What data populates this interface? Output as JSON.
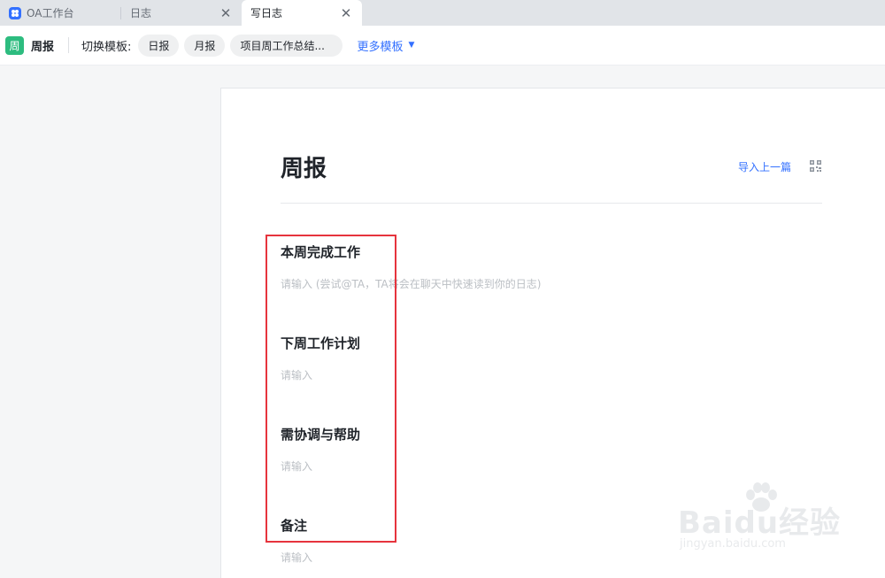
{
  "tabs": [
    {
      "label": "OA工作台",
      "active": false,
      "has_close": false,
      "icon": "oa-app-icon"
    },
    {
      "label": "日志",
      "active": false,
      "has_close": true
    },
    {
      "label": "写日志",
      "active": true,
      "has_close": true
    }
  ],
  "toolbar": {
    "badge": "周",
    "doc_name": "周报",
    "switch_label": "切换模板:",
    "templates": [
      "日报",
      "月报",
      "项目周工作总结..."
    ],
    "more_label": "更多模板"
  },
  "page": {
    "title": "周报",
    "import_label": "导入上一篇",
    "sections": [
      {
        "title": "本周完成工作",
        "placeholder": "请输入 (尝试@TA，TA将会在聊天中快速读到你的日志)"
      },
      {
        "title": "下周工作计划",
        "placeholder": "请输入"
      },
      {
        "title": "需协调与帮助",
        "placeholder": "请输入"
      },
      {
        "title": "备注",
        "placeholder": "请输入"
      }
    ]
  },
  "watermark": {
    "brand": "Baidu经验",
    "url": "jingyan.baidu.com"
  },
  "colors": {
    "accent": "#3370ff",
    "badge": "#2dbc7f",
    "highlight": "#e6343d"
  }
}
